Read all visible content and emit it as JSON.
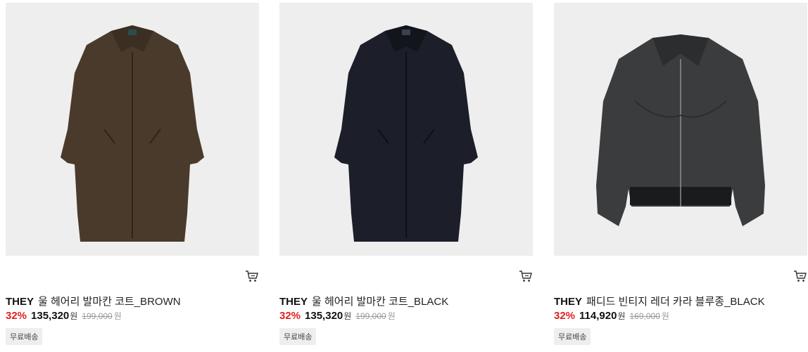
{
  "products": [
    {
      "brand": "THEY",
      "name": "울 헤어리 발마칸 코트_BROWN",
      "discount": "32%",
      "sale_price": "135,320",
      "sale_unit": "원",
      "original_price": "199,000",
      "original_unit": "원",
      "badge": "무료배송",
      "image_icon": "brown-wool-coat-image",
      "color": "#4a3a2b"
    },
    {
      "brand": "THEY",
      "name": "울 헤어리 발마칸 코트_BLACK",
      "discount": "32%",
      "sale_price": "135,320",
      "sale_unit": "원",
      "original_price": "199,000",
      "original_unit": "원",
      "badge": "무료배송",
      "image_icon": "black-wool-coat-image",
      "color": "#1c1f29"
    },
    {
      "brand": "THEY",
      "name": "패디드 빈티지 레더 카라 블루종_BLACK",
      "discount": "32%",
      "sale_price": "114,920",
      "sale_unit": "원",
      "original_price": "169,000",
      "original_unit": "원",
      "badge": "무료배송",
      "image_icon": "leather-jacket-image",
      "color": "#3a3c3e"
    }
  ],
  "colors": {
    "discount": "#e02020",
    "thumb_bg": "#eeeeee",
    "badge_bg": "#eeeeee"
  }
}
